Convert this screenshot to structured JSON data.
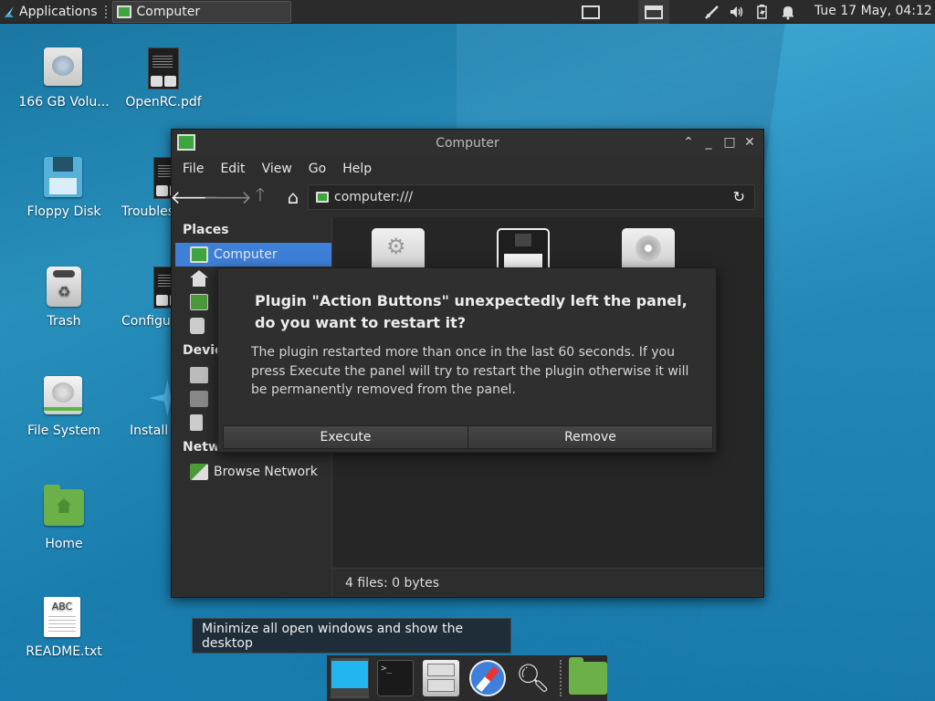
{
  "top_panel": {
    "apps_label": "Applications",
    "task_label": "Computer",
    "clock": "Tue 17 May, 04:12"
  },
  "desktop": {
    "icons": [
      {
        "label": "166 GB Volu..."
      },
      {
        "label": "OpenRC.pdf"
      },
      {
        "label": "Floppy Disk"
      },
      {
        "label": "Troubles"
      },
      {
        "label": "Trash"
      },
      {
        "label": "Configur"
      },
      {
        "label": "File System"
      },
      {
        "label": "Install"
      },
      {
        "label": "Home"
      },
      {
        "label": "README.txt"
      }
    ],
    "readme_icon_text": "ABC"
  },
  "file_manager": {
    "title": "Computer",
    "menu": [
      "File",
      "Edit",
      "View",
      "Go",
      "Help"
    ],
    "location": "computer:///",
    "sidebar": {
      "places_heading": "Places",
      "places_items": [
        "Computer"
      ],
      "devices_heading": "Devic",
      "network_heading": "Network",
      "network_items": [
        "Browse Network"
      ]
    },
    "status": "4 files: 0 bytes"
  },
  "dialog": {
    "title": "Plugin \"Action Buttons\" unexpectedly left the panel, do you want to restart it?",
    "message": "The plugin restarted more than once in the last 60 seconds. If you press Execute the panel will try to restart the plugin otherwise it will be permanently removed from the panel.",
    "execute_label": "Execute",
    "remove_label": "Remove"
  },
  "tooltip": {
    "text": "Minimize all open windows and show the desktop"
  },
  "colors": {
    "selection": "#3e80d8",
    "accent_green": "#6cb04a",
    "panel_bg": "#2b2b2b"
  }
}
